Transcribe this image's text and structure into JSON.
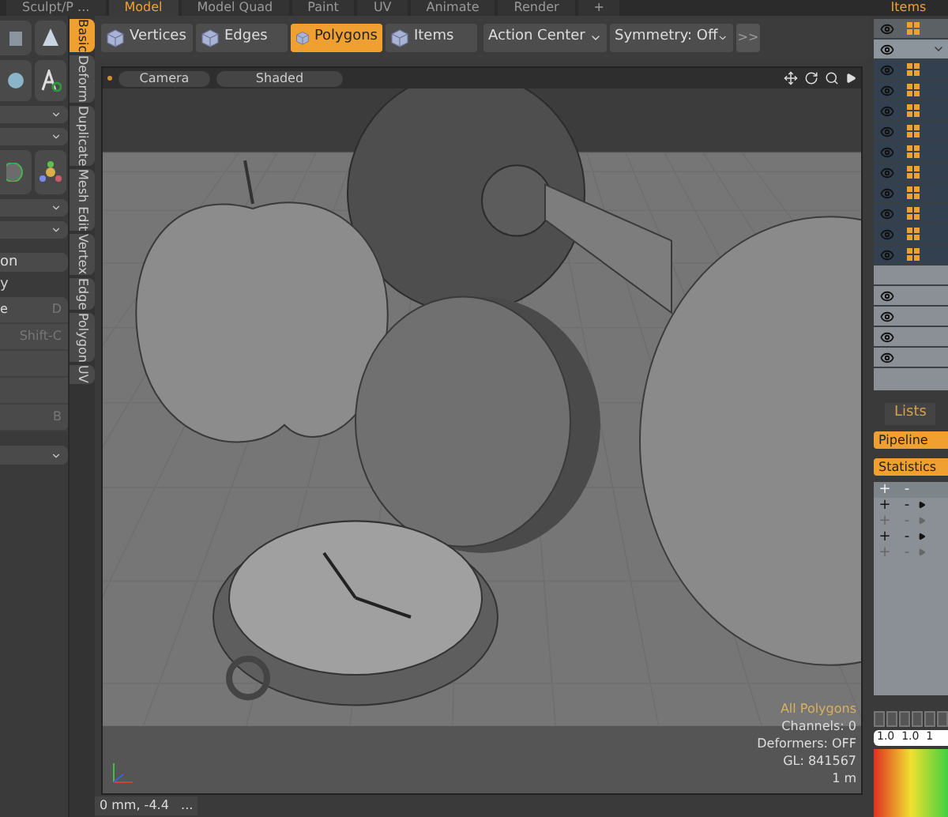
{
  "top_tabs": [
    {
      "label": "Sculpt/P ...",
      "selected": false
    },
    {
      "label": "Model",
      "selected": true
    },
    {
      "label": "Model Quad",
      "selected": false
    },
    {
      "label": "Paint",
      "selected": false
    },
    {
      "label": "UV",
      "selected": false
    },
    {
      "label": "Animate",
      "selected": false
    },
    {
      "label": "Render",
      "selected": false
    },
    {
      "label": "+",
      "selected": false
    }
  ],
  "left_panel": {
    "button_label": "on",
    "section_label": "y",
    "list": [
      {
        "kind": "command",
        "label": "e",
        "shortcut": "D"
      },
      {
        "kind": "command",
        "shortcut": "Shift-C"
      },
      {
        "kind": "blank"
      },
      {
        "kind": "blank"
      },
      {
        "kind": "command",
        "shortcut": "B"
      }
    ]
  },
  "side_tabs": [
    {
      "label": "Basic",
      "selected": true
    },
    {
      "label": "Deform",
      "selected": false
    },
    {
      "label": "Duplicate",
      "selected": false
    },
    {
      "label": "Mesh Edit",
      "selected": false
    },
    {
      "label": "Vertex",
      "selected": false
    },
    {
      "label": "Edge",
      "selected": false
    },
    {
      "label": "Polygon",
      "selected": false
    },
    {
      "label": "UV",
      "selected": false
    }
  ],
  "toolbar": {
    "modes": [
      {
        "label": "Vertices",
        "selected": false
      },
      {
        "label": "Edges",
        "selected": false
      },
      {
        "label": "Polygons",
        "selected": true
      },
      {
        "label": "Items",
        "selected": false
      }
    ],
    "action_center": "Action Center",
    "symmetry": "Symmetry: Off",
    "more": ">>"
  },
  "viewport": {
    "camera": "Camera",
    "shading": "Shaded",
    "selection": "All Polygons",
    "info": [
      "Channels: 0",
      "Deformers: OFF",
      "GL: 841567",
      "1 m"
    ]
  },
  "status": "0 mm, -4.4   ...",
  "items_panel": {
    "title": "Items",
    "rows": [
      {
        "kind": "header",
        "selected": false
      },
      {
        "kind": "group",
        "selected": false
      },
      {
        "kind": "mesh",
        "selected": true
      },
      {
        "kind": "mesh",
        "selected": true
      },
      {
        "kind": "mesh",
        "selected": true
      },
      {
        "kind": "mesh",
        "selected": true
      },
      {
        "kind": "mesh",
        "selected": true
      },
      {
        "kind": "mesh",
        "selected": true
      },
      {
        "kind": "mesh",
        "selected": true
      },
      {
        "kind": "mesh",
        "selected": true
      },
      {
        "kind": "mesh",
        "selected": true
      },
      {
        "kind": "mesh",
        "selected": true
      },
      {
        "kind": "gap",
        "selected": false
      },
      {
        "kind": "light",
        "selected": false
      },
      {
        "kind": "light",
        "selected": false
      },
      {
        "kind": "light",
        "selected": false
      },
      {
        "kind": "light",
        "selected": false
      }
    ]
  },
  "lists_panel": {
    "tab": "Lists",
    "pipeline": "Pipeline",
    "statistics": "Statistics",
    "header": [
      "+",
      "-"
    ],
    "rows": [
      {
        "plus": "+",
        "minus": "-",
        "active": true
      },
      {
        "plus": "+",
        "minus": "-",
        "active": false
      },
      {
        "plus": "+",
        "minus": "-",
        "active": true
      },
      {
        "plus": "+",
        "minus": "-",
        "active": false
      }
    ]
  },
  "color_values": "1.0  1.0  1"
}
